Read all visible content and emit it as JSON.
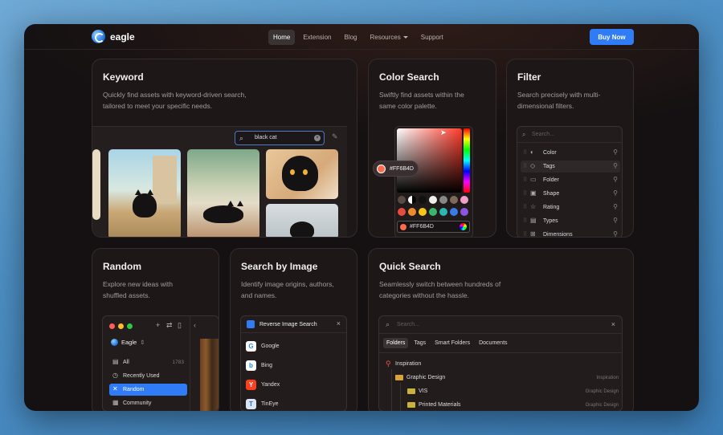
{
  "nav": {
    "logo_text": "eagle",
    "links": [
      {
        "label": "Home"
      },
      {
        "label": "Extension"
      },
      {
        "label": "Blog"
      },
      {
        "label": "Resources"
      },
      {
        "label": "Support"
      }
    ],
    "buy_label": "Buy Now",
    "accent_color": "#2f7cf6"
  },
  "keyword": {
    "title": "Keyword",
    "desc1": "Quickly find assets with keyword-driven search,",
    "desc2": "tailored to meet your specific needs.",
    "search_value": "black cat"
  },
  "color_search": {
    "title": "Color Search",
    "desc1": "Swiftly find assets within the",
    "desc2": "same color palette.",
    "chip_hex": "#FF6B4D",
    "input_hex": "#FF6B4D",
    "selected_color": "#ff6b4d"
  },
  "filter": {
    "title": "Filter",
    "desc1": "Search precisely with multi-",
    "desc2": "dimensional filters.",
    "placeholder": "Search...",
    "items": [
      {
        "label": "Color",
        "icon": "palette-icon"
      },
      {
        "label": "Tags",
        "icon": "tag-icon"
      },
      {
        "label": "Folder",
        "icon": "folder-icon"
      },
      {
        "label": "Shape",
        "icon": "shape-icon"
      },
      {
        "label": "Rating",
        "icon": "star-icon"
      },
      {
        "label": "Types",
        "icon": "file-type-icon"
      },
      {
        "label": "Dimensions",
        "icon": "dimensions-icon"
      }
    ]
  },
  "random": {
    "title": "Random",
    "desc1": "Explore new ideas with",
    "desc2": "shuffled assets.",
    "library": "Eagle",
    "items": [
      {
        "label": "All",
        "count": "1783"
      },
      {
        "label": "Recently Used",
        "count": ""
      },
      {
        "label": "Random",
        "count": ""
      },
      {
        "label": "Community",
        "count": ""
      }
    ]
  },
  "search_by_image": {
    "title": "Search by Image",
    "desc1": "Identify image origins, authors,",
    "desc2": "and names.",
    "panel_title": "Reverse Image Search",
    "engines": [
      {
        "label": "Google",
        "letter": "G",
        "color": "#4285f4"
      },
      {
        "label": "Bing",
        "letter": "b",
        "color": "#1a8cd8"
      },
      {
        "label": "Yandex",
        "letter": "Y",
        "color": "#ffffff"
      },
      {
        "label": "TinEye",
        "letter": "T",
        "color": "#3b6db3"
      }
    ]
  },
  "quick_search": {
    "title": "Quick Search",
    "desc1": "Seamlessly switch between hundreds of",
    "desc2": "categories without the hassle.",
    "placeholder": "Search...",
    "tabs": [
      "Folders",
      "Tags",
      "Smart Folders",
      "Documents"
    ],
    "rows": [
      {
        "label": "Inspiration",
        "parent": ""
      },
      {
        "label": "Graphic Design",
        "parent": "Inspiration"
      },
      {
        "label": "VIS",
        "parent": "Graphic Design"
      },
      {
        "label": "Printed Materials",
        "parent": "Graphic Design"
      }
    ]
  }
}
